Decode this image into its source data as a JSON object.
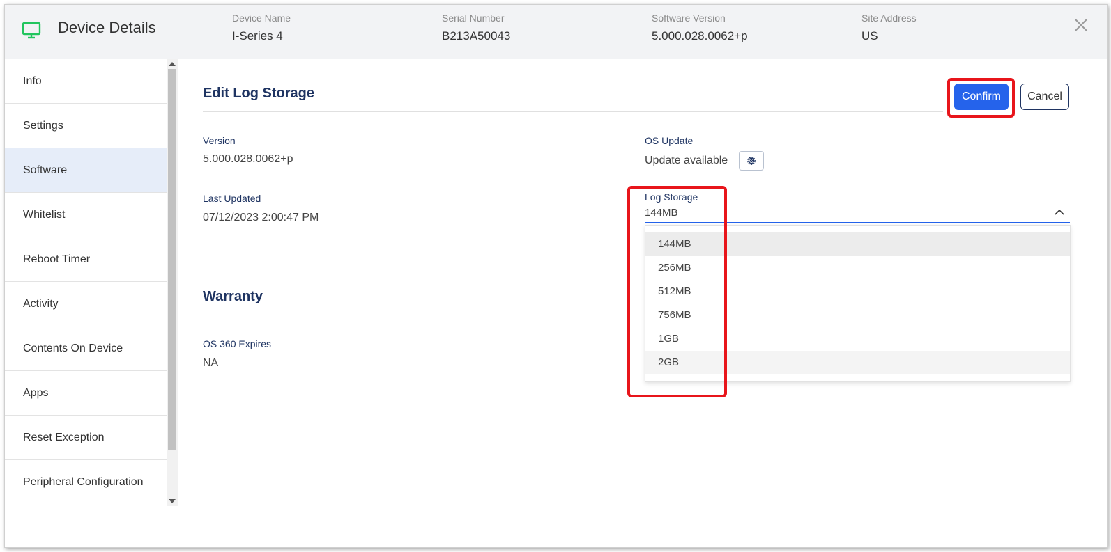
{
  "header": {
    "title": "Device Details",
    "fields": [
      {
        "label": "Device Name",
        "value": "I-Series 4"
      },
      {
        "label": "Serial Number",
        "value": "B213A50043"
      },
      {
        "label": "Software Version",
        "value": "5.000.028.0062+p"
      },
      {
        "label": "Site Address",
        "value": "US"
      }
    ]
  },
  "sidebar": {
    "items": [
      {
        "label": "Info"
      },
      {
        "label": "Settings"
      },
      {
        "label": "Software",
        "active": true
      },
      {
        "label": "Whitelist"
      },
      {
        "label": "Reboot Timer"
      },
      {
        "label": "Activity"
      },
      {
        "label": "Contents On Device"
      },
      {
        "label": "Apps"
      },
      {
        "label": "Reset Exception"
      },
      {
        "label": "Peripheral Configuration"
      }
    ]
  },
  "edit_section": {
    "title": "Edit Log Storage",
    "confirm_label": "Confirm",
    "cancel_label": "Cancel",
    "version_label": "Version",
    "version_value": "5.000.028.0062+p",
    "last_updated_label": "Last Updated",
    "last_updated_value": "07/12/2023 2:00:47 PM",
    "os_update_label": "OS Update",
    "os_update_value": "Update available",
    "log_storage_label": "Log Storage",
    "log_storage_value": "144MB",
    "log_storage_options": [
      "144MB",
      "256MB",
      "512MB",
      "756MB",
      "1GB",
      "2GB"
    ]
  },
  "warranty": {
    "title": "Warranty",
    "os360_label": "OS 360 Expires",
    "os360_value": "NA"
  },
  "colors": {
    "accent": "#2563eb",
    "heading": "#1f3462",
    "highlight": "#e8151b",
    "monitor_icon": "#22c55e"
  }
}
